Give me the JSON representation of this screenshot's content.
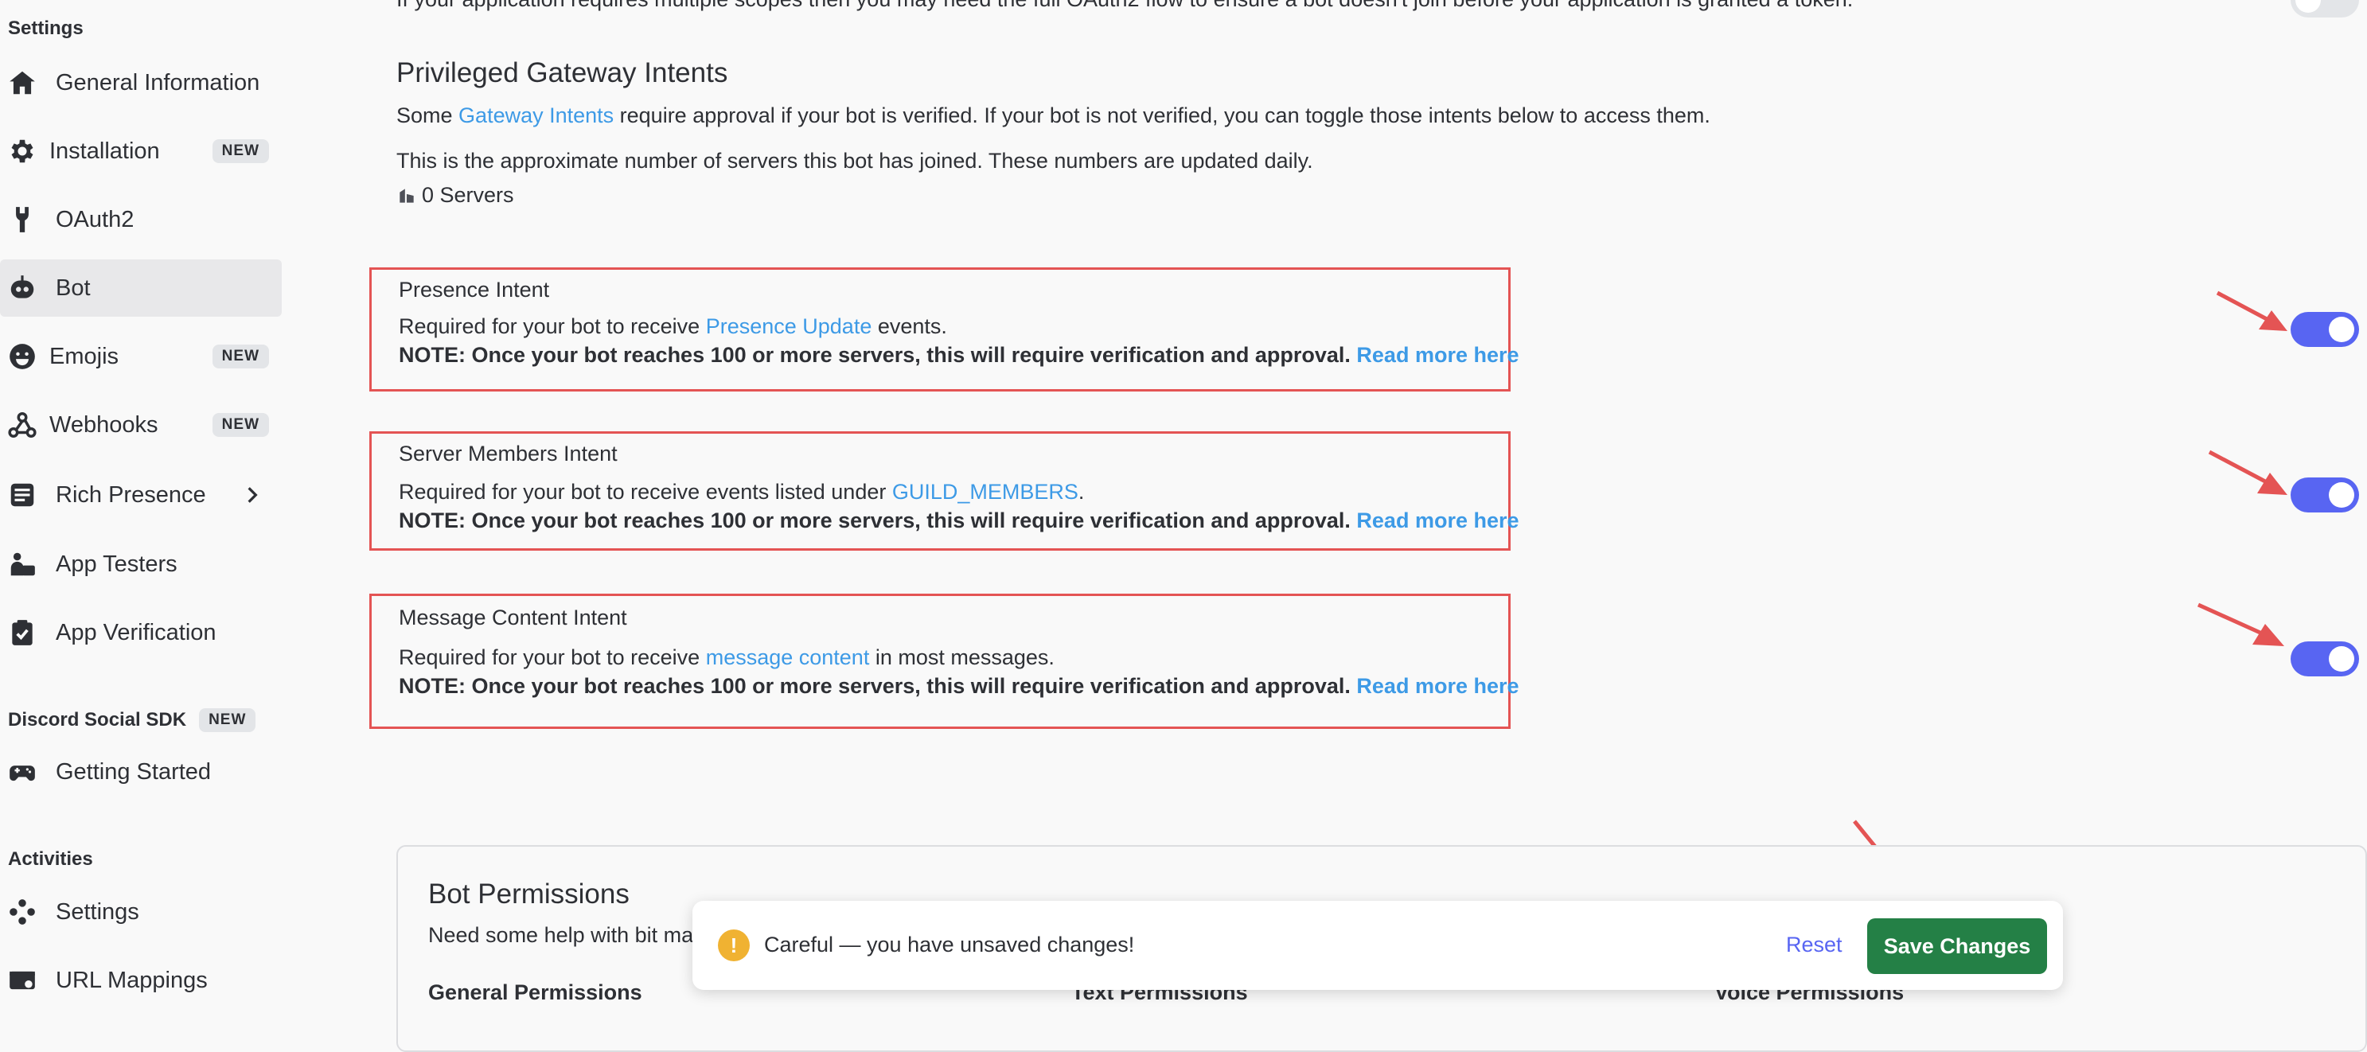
{
  "sidebar": {
    "settings_header": "Settings",
    "items": [
      {
        "label": "General Information",
        "icon": "home-icon",
        "badge": ""
      },
      {
        "label": "Installation",
        "icon": "gear-icon",
        "badge": "NEW"
      },
      {
        "label": "OAuth2",
        "icon": "wrench-icon",
        "badge": ""
      },
      {
        "label": "Bot",
        "icon": "robot-icon",
        "badge": ""
      },
      {
        "label": "Emojis",
        "icon": "emoji-icon",
        "badge": "NEW"
      },
      {
        "label": "Webhooks",
        "icon": "webhook-icon",
        "badge": "NEW"
      },
      {
        "label": "Rich Presence",
        "icon": "rich-presence-icon",
        "badge": ""
      },
      {
        "label": "App Testers",
        "icon": "app-testers-icon",
        "badge": ""
      },
      {
        "label": "App Verification",
        "icon": "clipboard-check-icon",
        "badge": ""
      }
    ],
    "sdk_header": "Discord Social SDK",
    "sdk_badge": "NEW",
    "sdk_items": [
      {
        "label": "Getting Started",
        "icon": "gamepad-icon"
      }
    ],
    "activities_header": "Activities",
    "activities_items": [
      {
        "label": "Settings",
        "icon": "activities-settings-icon"
      },
      {
        "label": "URL Mappings",
        "icon": "url-mappings-icon"
      }
    ]
  },
  "main": {
    "top_partial_text": "If your application requires multiple scopes then you may need the full OAuth2 flow to ensure a bot doesn't join before your application is granted a token.",
    "section_title": "Privileged Gateway Intents",
    "intro_pre": "Some ",
    "intro_link": "Gateway Intents",
    "intro_post": " require approval if your bot is verified. If your bot is not verified, you can toggle those intents below to access them.",
    "servers_note": "This is the approximate number of servers this bot has joined. These numbers are updated daily.",
    "servers_count": "0 Servers",
    "note_text": "NOTE: Once your bot reaches 100 or more servers, this will require verification and approval.",
    "read_more": "Read more here",
    "intents": [
      {
        "title": "Presence Intent",
        "desc_pre": "Required for your bot to receive ",
        "desc_link": "Presence Update",
        "desc_post": " events.",
        "enabled": true
      },
      {
        "title": "Server Members Intent",
        "desc_pre": "Required for your bot to receive events listed under ",
        "desc_link": "GUILD_MEMBERS",
        "desc_post": ".",
        "enabled": true
      },
      {
        "title": "Message Content Intent",
        "desc_pre": "Required for your bot to receive ",
        "desc_link": "message content",
        "desc_post": " in most messages.",
        "enabled": true
      }
    ],
    "bot_permissions": {
      "title": "Bot Permissions",
      "subtitle": "Need some help with bit ma",
      "columns": [
        "General Permissions",
        "Text Permissions",
        "Voice Permissions"
      ]
    }
  },
  "unsaved_bar": {
    "message": "Careful — you have unsaved changes!",
    "reset_label": "Reset",
    "save_label": "Save Changes",
    "warn_glyph": "!"
  },
  "colors": {
    "accent": "#5865f2",
    "link": "#3d9ae6",
    "save": "#248046",
    "highlight_box": "#e45454",
    "annotation_arrow": "#e45454",
    "warning": "#f0b232"
  }
}
